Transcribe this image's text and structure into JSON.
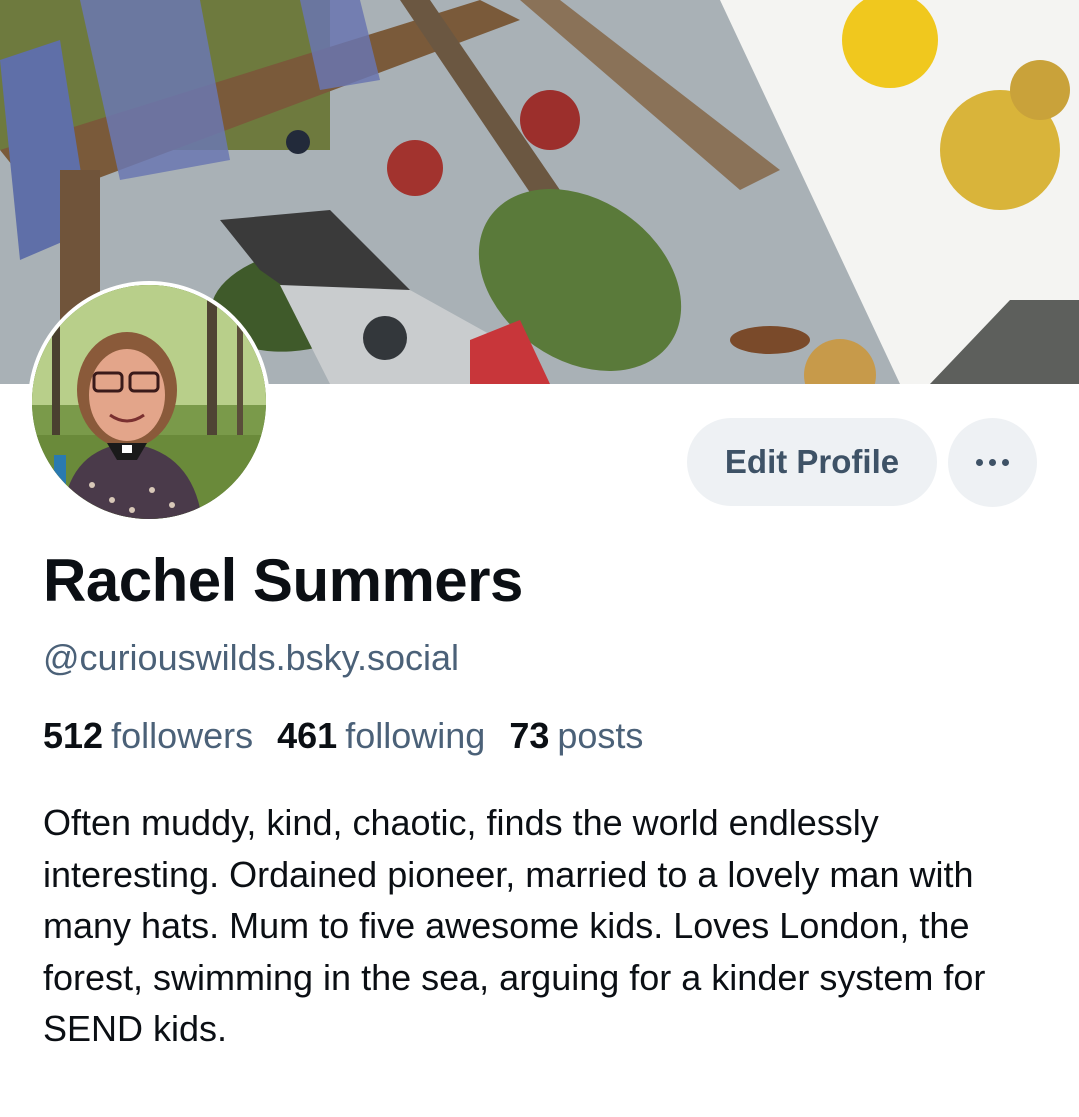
{
  "banner": {
    "icon": "banner-photo"
  },
  "avatar": {
    "icon": "profile-photo"
  },
  "actions": {
    "edit_profile_label": "Edit Profile",
    "more_icon": "ellipsis-icon"
  },
  "profile": {
    "name": "Rachel Summers",
    "handle": "@curiouswilds.bsky.social",
    "stats": [
      {
        "count": "512",
        "label": "followers"
      },
      {
        "count": "461",
        "label": "following"
      },
      {
        "count": "73",
        "label": "posts"
      }
    ],
    "bio": "Often muddy, kind, chaotic, finds the world endlessly interesting. Ordained pioneer, married to a lovely man with many hats. Mum to five awesome kids. Loves London, the forest, swimming in the sea, arguing for a kinder system for SEND kids."
  },
  "colors": {
    "button_bg": "#eef1f4",
    "button_text": "#3e5266",
    "secondary_text": "#4b6178",
    "primary_text": "#0b0f14"
  }
}
